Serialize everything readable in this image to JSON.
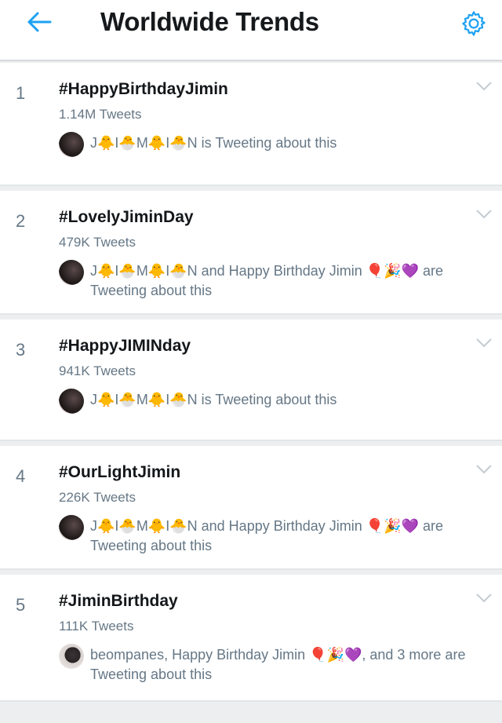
{
  "header": {
    "title": "Worldwide Trends",
    "accent_color": "#1da1f2",
    "back_icon": "arrow-left-icon",
    "settings_icon": "gear-icon"
  },
  "trends": [
    {
      "rank": "1",
      "name": "#HappyBirthdayJimin",
      "tweets": "1.14M Tweets",
      "context": "J🐥I🐣M🐥I🐣N is Tweeting about this"
    },
    {
      "rank": "2",
      "name": "#LovelyJiminDay",
      "tweets": "479K Tweets",
      "context": "J🐥I🐣M🐥I🐣N and Happy Birthday Jimin 🎈🎉💜 are Tweeting about this"
    },
    {
      "rank": "3",
      "name": "#HappyJIMINday",
      "tweets": "941K Tweets",
      "context": "J🐥I🐣M🐥I🐣N is Tweeting about this"
    },
    {
      "rank": "4",
      "name": "#OurLightJimin",
      "tweets": "226K Tweets",
      "context": "J🐥I🐣M🐥I🐣N and Happy Birthday Jimin 🎈🎉💜 are Tweeting about this"
    },
    {
      "rank": "5",
      "name": "#JiminBirthday",
      "tweets": "111K Tweets",
      "context": "beompanes, Happy Birthday Jimin 🎈🎉💜, and 3 more are Tweeting about this"
    }
  ]
}
